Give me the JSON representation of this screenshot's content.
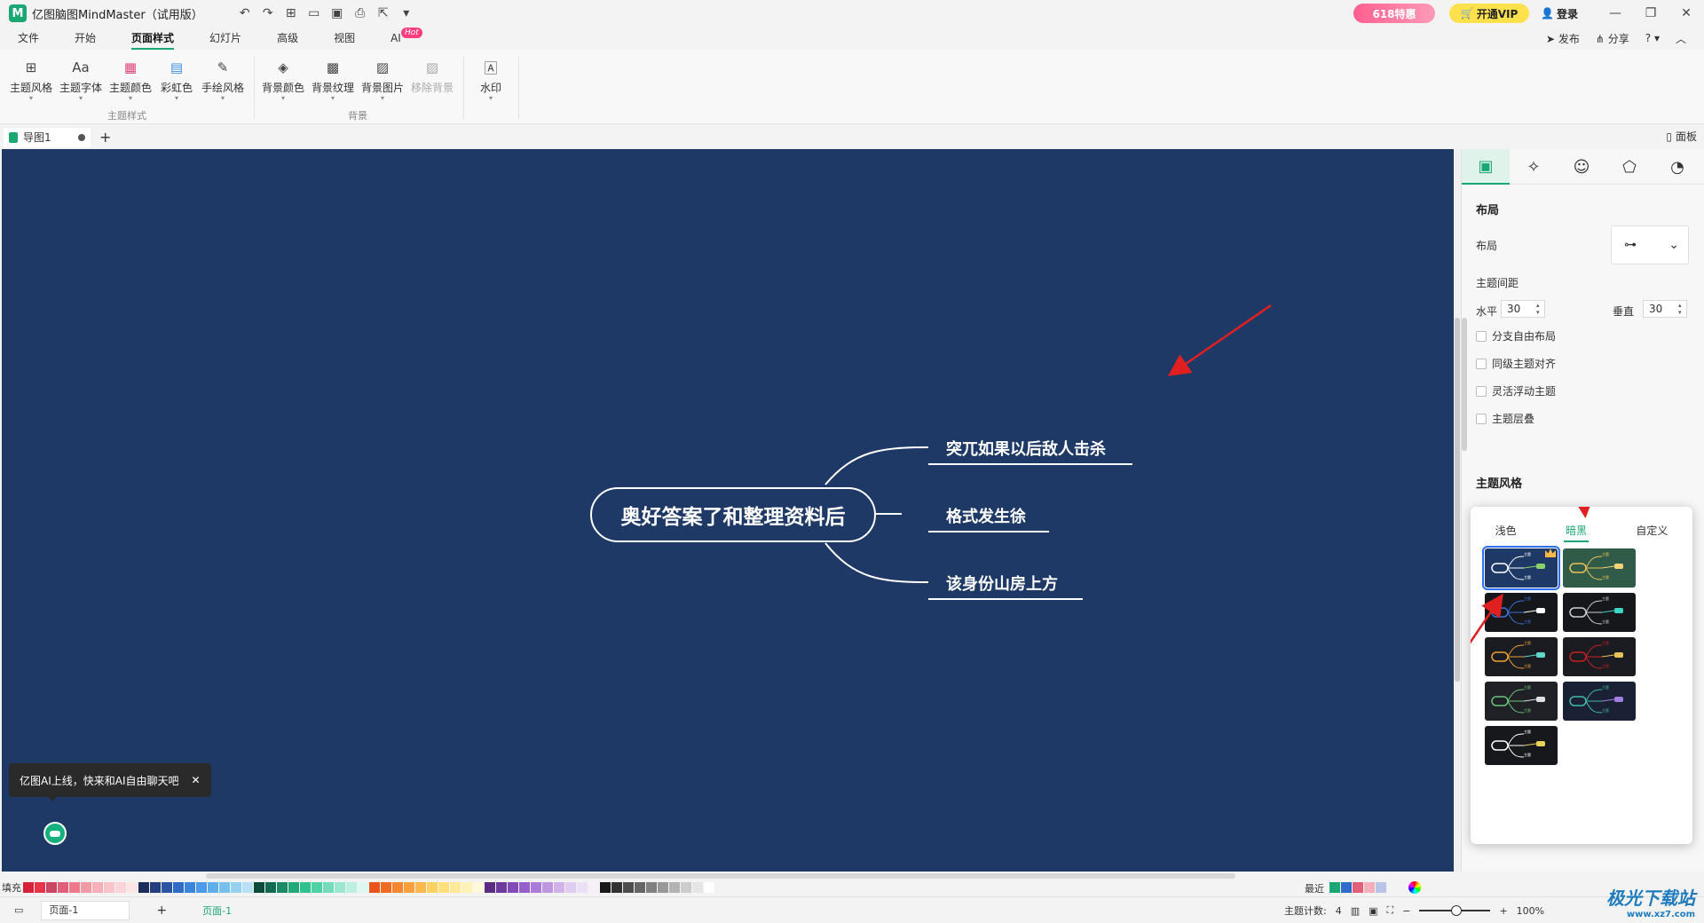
{
  "app": {
    "logo": "M",
    "title": "亿图脑图MindMaster（试用版）"
  },
  "titlebar": {
    "promo": "618特惠",
    "vip": "开通VIP",
    "login": "登录"
  },
  "menu": {
    "tabs": [
      "文件",
      "开始",
      "页面样式",
      "幻灯片",
      "高级",
      "视图",
      "AI"
    ],
    "hot": "Hot",
    "right": {
      "publish": "发布",
      "share": "分享",
      "help": "?"
    }
  },
  "ribbon": {
    "group1": {
      "label": "主题样式",
      "buttons": [
        "主题风格",
        "主题字体",
        "主题颜色",
        "彩虹色",
        "手绘风格"
      ]
    },
    "group2": {
      "label": "背景",
      "buttons": [
        "背景颜色",
        "背景纹理",
        "背景图片",
        "移除背景"
      ]
    },
    "group3": {
      "buttons": [
        "水印"
      ]
    }
  },
  "doctabs": {
    "tab": "导图1",
    "panel": "面板"
  },
  "mindmap": {
    "central": "奥好答案了和整理资料后",
    "topics": [
      "突兀如果以后敌人击杀",
      "格式发生徐",
      "该身份山房上方"
    ]
  },
  "ai_tip": "亿图AI上线，快来和AI自由聊天吧",
  "panel": {
    "layout_section": "布局",
    "layout_label": "布局",
    "spacing_label": "主题间距",
    "horizontal_label": "水平",
    "horizontal_value": "30",
    "vertical_label": "垂直",
    "vertical_value": "30",
    "checks": [
      "分支自由布局",
      "同级主题对齐",
      "灵活浮动主题",
      "主题层叠"
    ],
    "theme_section": "主题风格"
  },
  "popup": {
    "tabs": [
      "浅色",
      "暗黑",
      "自定义"
    ],
    "thumb_label": "主题"
  },
  "colorbar": {
    "fill_label": "填充",
    "recent_label": "最近"
  },
  "status": {
    "page_select": "页面-1",
    "page_tab": "页面-1",
    "topic_count_label": "主题计数:",
    "topic_count": "4",
    "zoom": "100%"
  },
  "watermark": {
    "brand": "极光下载站",
    "url": "www.xz7.com"
  }
}
